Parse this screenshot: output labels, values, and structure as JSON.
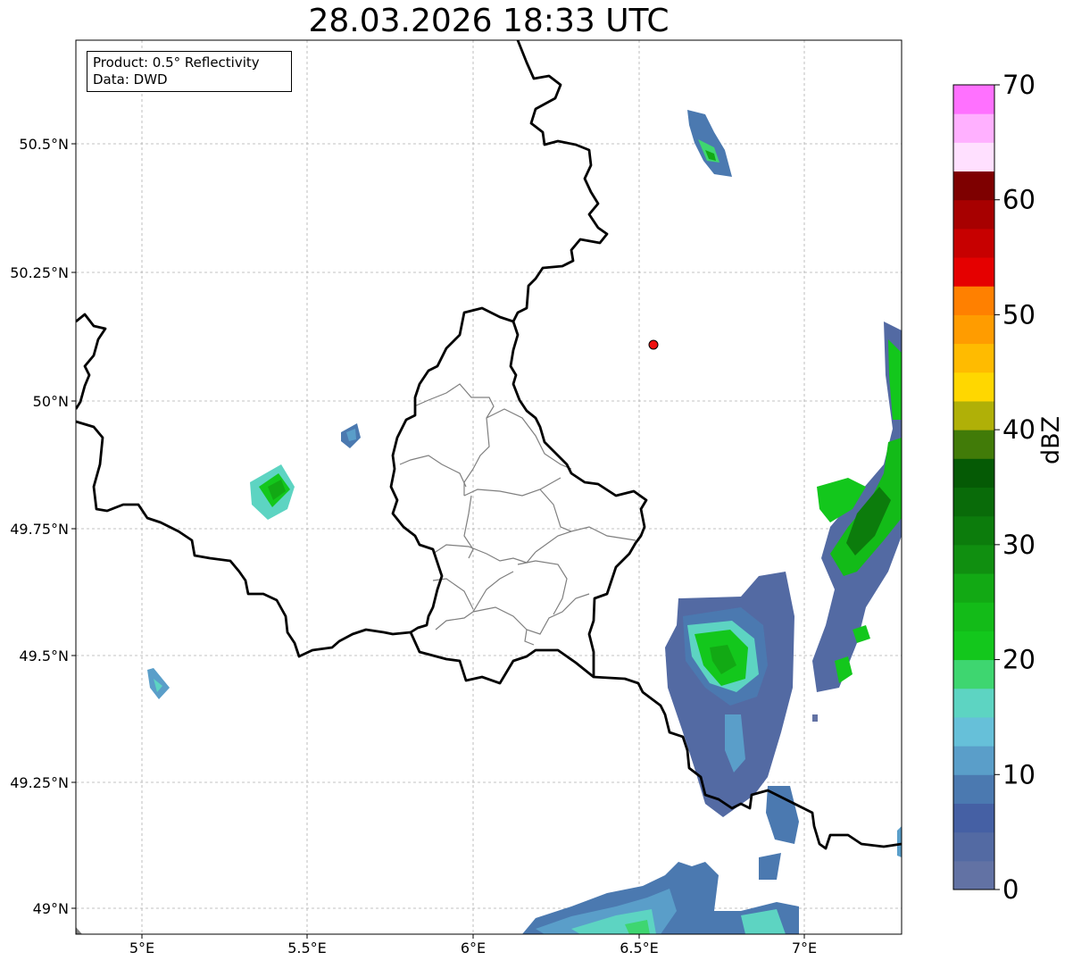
{
  "title": "28.03.2026 18:33 UTC",
  "info": {
    "product": "Product: 0.5° Reflectivity",
    "data": "Data: DWD"
  },
  "axes": {
    "x_ticks": [
      "5°E",
      "5.5°E",
      "6°E",
      "6.5°E",
      "7°E"
    ],
    "y_ticks": [
      "50.5°N",
      "50.25°N",
      "50°N",
      "49.75°N",
      "49.5°N",
      "49.25°N",
      "49°N"
    ]
  },
  "colorbar": {
    "label": "dBZ",
    "ticks": [
      "0",
      "10",
      "20",
      "30",
      "40",
      "50",
      "60",
      "70"
    ],
    "min": 0,
    "max": 70,
    "step": 2.5,
    "colors": [
      "#6272a4",
      "#536aa3",
      "#4560a4",
      "#4b79b0",
      "#5a9ec9",
      "#66c0d9",
      "#5dd4c2",
      "#3ed670",
      "#13c71c",
      "#13bb18",
      "#12a914",
      "#108f10",
      "#0c7c0c",
      "#096b09",
      "#055a05",
      "#417b08",
      "#b0b007",
      "#ffd700",
      "#ffbb00",
      "#ff9c00",
      "#ff8000",
      "#e50000",
      "#c70000",
      "#a70000",
      "#7e0000",
      "#ffe0ff",
      "#ffb0ff",
      "#ff71ff",
      "#ec38ec"
    ]
  },
  "colors": {
    "border": "#000000",
    "district": "#7f7f7f",
    "grid": "#b0b0b0",
    "radar_site": "#ee1111"
  }
}
